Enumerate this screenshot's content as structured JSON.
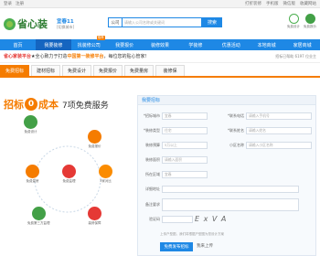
{
  "topbar": {
    "left": [
      "登录",
      "注册"
    ],
    "right": [
      "打折装修",
      "手机版",
      "微信版",
      "收藏网站"
    ]
  },
  "header": {
    "logo": "省心装",
    "city": "宜春11",
    "city_sub": "[切换城市]",
    "search_type": "公司",
    "search_placeholder": "请输入公司名称或关键词",
    "search_button": "搜索",
    "icon_labels": [
      "免费设计",
      "免费报价"
    ]
  },
  "nav": [
    {
      "label": "首页",
      "active": false,
      "badge": ""
    },
    {
      "label": "我要装修",
      "active": true,
      "badge": ""
    },
    {
      "label": "找装修公司",
      "active": false,
      "badge": "推荐"
    },
    {
      "label": "我要报价",
      "active": false,
      "badge": ""
    },
    {
      "label": "装修效果",
      "active": false,
      "badge": ""
    },
    {
      "label": "学装修",
      "active": false,
      "badge": ""
    },
    {
      "label": "优惠活动",
      "active": false,
      "badge": ""
    },
    {
      "label": "本地商城",
      "active": false,
      "badge": ""
    },
    {
      "label": "家居商城",
      "active": false,
      "badge": ""
    }
  ],
  "banner": {
    "pre": "省心家装平台",
    "mid": "★全心致力于打造",
    "hl": "中国第一装修平台",
    "post": "，每位您的贴心管家!",
    "right": "招标已帮助 6197 位业主"
  },
  "tabs": [
    "免费招标",
    "建材招标",
    "免费设计",
    "免费报价",
    "免费量房",
    "装修保"
  ],
  "promo": {
    "pre": "招标",
    "zero": "0",
    "post": "成本",
    "service": "7项免费服务"
  },
  "services": [
    "免费设计",
    "免费报价",
    "免费量房",
    "免费监理",
    "3家对比",
    "免费第三方监理",
    "装修保障"
  ],
  "form": {
    "title": "我要招标",
    "labels": [
      "*招标城市",
      "*装修类型",
      "装修预算",
      "装修面积",
      "所在区域",
      "详细地址",
      "备注要求",
      "验证码"
    ],
    "values": [
      "宜春",
      "住宅",
      "5万以上",
      "请输入面积",
      "宜春",
      "",
      "",
      ""
    ],
    "right_labels": [
      "*联系电话",
      "*联系姓名",
      "小区名称"
    ],
    "right_values": [
      "请输入手机号",
      "请输入姓名",
      "请输入小区名称"
    ],
    "captcha": "E x V A",
    "upload_note": "上传户型图，我们将根据户型图为您设计方案",
    "submit": "免费发布招标",
    "reset": "我来上传"
  }
}
